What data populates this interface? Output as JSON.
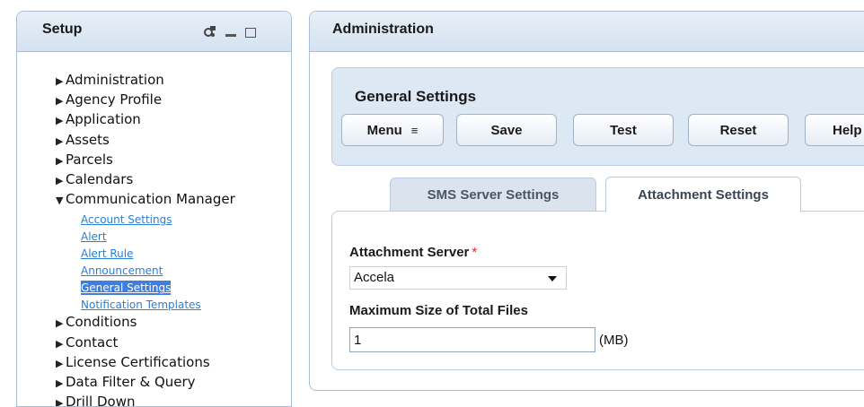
{
  "setup": {
    "title": "Setup",
    "tree": [
      {
        "label": "Administration",
        "expanded": false
      },
      {
        "label": "Agency Profile",
        "expanded": false
      },
      {
        "label": "Application",
        "expanded": false
      },
      {
        "label": "Assets",
        "expanded": false
      },
      {
        "label": "Parcels",
        "expanded": false
      },
      {
        "label": "Calendars",
        "expanded": false
      },
      {
        "label": "Communication Manager",
        "expanded": true,
        "children": [
          {
            "label": "Account Settings",
            "selected": false
          },
          {
            "label": "Alert",
            "selected": false
          },
          {
            "label": "Alert Rule",
            "selected": false
          },
          {
            "label": "Announcement",
            "selected": false
          },
          {
            "label": "General Settings",
            "selected": true
          },
          {
            "label": "Notification Templates",
            "selected": false
          }
        ]
      },
      {
        "label": "Conditions",
        "expanded": false
      },
      {
        "label": "Contact",
        "expanded": false
      },
      {
        "label": "License Certifications",
        "expanded": false
      },
      {
        "label": "Data Filter & Query",
        "expanded": false
      },
      {
        "label": "Drill Down",
        "expanded": false
      }
    ],
    "icons": [
      "refresh-icon",
      "minimize-icon",
      "maximize-icon"
    ]
  },
  "admin": {
    "title": "Administration",
    "section_title": "General Settings",
    "toolbar": {
      "menu_label": "Menu",
      "menu_glyph": "≡",
      "save_label": "Save",
      "test_label": "Test",
      "reset_label": "Reset",
      "help_label": "Help"
    },
    "tabs": [
      {
        "label": "SMS Server Settings",
        "active": false
      },
      {
        "label": "Attachment Settings",
        "active": true
      }
    ],
    "form": {
      "server_label": "Attachment Server",
      "required_mark": "*",
      "server_value": "Accela",
      "max_size_label": "Maximum Size of Total Files",
      "max_size_value": "1",
      "max_size_unit": "(MB)"
    }
  },
  "colors": {
    "header_bg": "#d4e2f1",
    "link": "#2a7fd4",
    "selected_bg": "#3e7ee0",
    "required": "#d9261c"
  }
}
